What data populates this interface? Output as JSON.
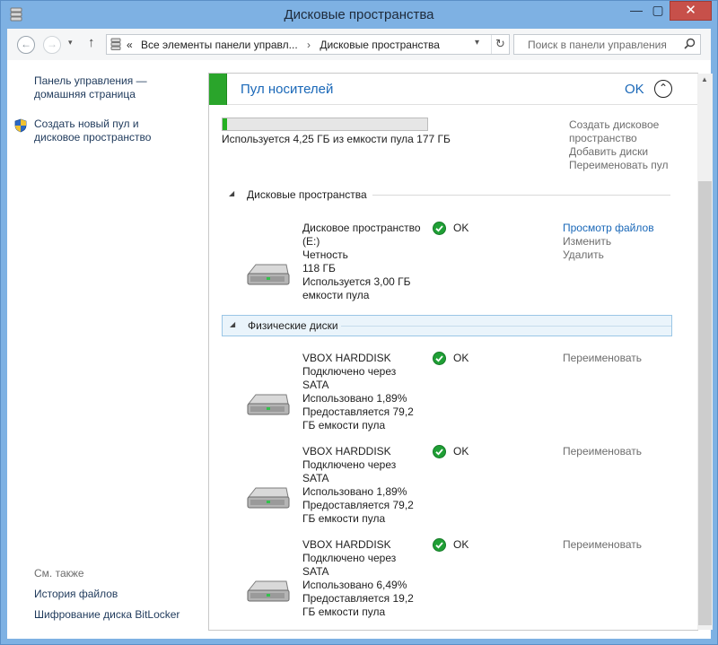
{
  "window": {
    "title": "Дисковые пространства",
    "minimize": "—",
    "maximize": "▢",
    "close": "✕"
  },
  "toolbar": {
    "back": "←",
    "forward": "→",
    "dropdown": "▾",
    "up": "↑",
    "breadcrumb": [
      "«",
      "Все элементы панели управл...",
      "›",
      "Дисковые пространства"
    ],
    "refresh": "↻",
    "search_placeholder": "Поиск в панели управления"
  },
  "sidebar": {
    "home_link": "Панель управления — домашняя страница",
    "home_line1": "Панель управления —",
    "home_line2": "домашняя страница",
    "create_line1": "Создать новый пул и",
    "create_line2": "дисковое пространство",
    "see_also": "См. также",
    "file_history": "История файлов",
    "bitlocker": "Шифрование диска BitLocker"
  },
  "pool": {
    "title": "Пул носителей",
    "status": "OK",
    "collapse": "⌃",
    "usage_fraction": 0.024,
    "usage_text": "Используется 4,25 ГБ из емкости пула 177 ГБ",
    "actions": {
      "create_line1": "Создать дисковое",
      "create_line2": "пространство",
      "add": "Добавить диски",
      "rename": "Переименовать пул"
    }
  },
  "spaces_group": {
    "label": "Дисковые пространства",
    "tri": "◢"
  },
  "space": {
    "lines": [
      "Дисковое пространство",
      "(E:)",
      "Четность",
      "118 ГБ",
      "Используется 3,00 ГБ",
      "емкости пула"
    ],
    "status": "OK",
    "actions": [
      "Просмотр файлов",
      "Изменить",
      "Удалить"
    ]
  },
  "physical_group": {
    "label": "Физические диски",
    "tri": "◢"
  },
  "disks": [
    {
      "lines": [
        "VBOX HARDDISK",
        "Подключено через",
        "SATA",
        "Использовано 1,89%",
        "Предоставляется 79,2",
        "ГБ емкости пула"
      ],
      "status": "OK",
      "action": "Переименовать"
    },
    {
      "lines": [
        "VBOX HARDDISK",
        "Подключено через",
        "SATA",
        "Использовано 1,89%",
        "Предоставляется 79,2",
        "ГБ емкости пула"
      ],
      "status": "OK",
      "action": "Переименовать"
    },
    {
      "lines": [
        "VBOX HARDDISK",
        "Подключено через",
        "SATA",
        "Использовано 6,49%",
        "Предоставляется 19,2",
        "ГБ емкости пула"
      ],
      "status": "OK",
      "action": "Переименовать"
    }
  ],
  "colors": {
    "accent_green": "#2aa52b",
    "link_blue": "#1a68b8",
    "frame": "#7eb1e3",
    "close_red": "#c7504a"
  },
  "icons": {
    "title": "storage-icon",
    "shield": "uac-shield-icon",
    "drive": "hard-drive-icon",
    "ok": "ok-check-icon",
    "search": "search-icon"
  }
}
